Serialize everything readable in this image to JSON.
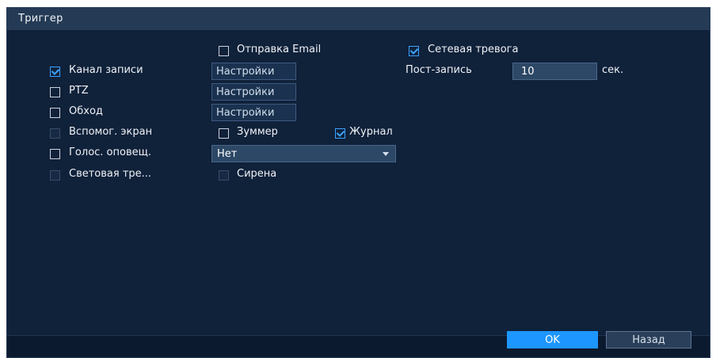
{
  "dialog": {
    "title": "Триггер"
  },
  "email": {
    "label": "Отправка Email",
    "checked": false
  },
  "network_alarm": {
    "label": "Сетевая тревога",
    "checked": true
  },
  "record_channel": {
    "label": "Канал записи",
    "checked": true,
    "settings_label": "Настройки"
  },
  "post_record": {
    "label": "Пост-запись",
    "value": "10",
    "unit": "сек."
  },
  "ptz": {
    "label": "PTZ",
    "checked": false,
    "settings_label": "Настройки"
  },
  "tour": {
    "label": "Обход",
    "checked": false,
    "settings_label": "Настройки"
  },
  "aux_screen": {
    "label": "Вспомог. экран",
    "checked": false
  },
  "buzzer": {
    "label": "Зуммер",
    "checked": false
  },
  "log": {
    "label": "Журнал",
    "checked": true
  },
  "voice_prompt": {
    "label": "Голос. оповещ.",
    "checked": false,
    "selected": "Нет"
  },
  "light_alarm": {
    "label": "Световая тре...",
    "checked": false
  },
  "siren": {
    "label": "Сирена",
    "checked": false
  },
  "footer": {
    "ok_label": "OK",
    "back_label": "Назад"
  },
  "colors": {
    "accent": "#1e96ff",
    "panel": "#10213a",
    "titlebar": "#243a55"
  }
}
